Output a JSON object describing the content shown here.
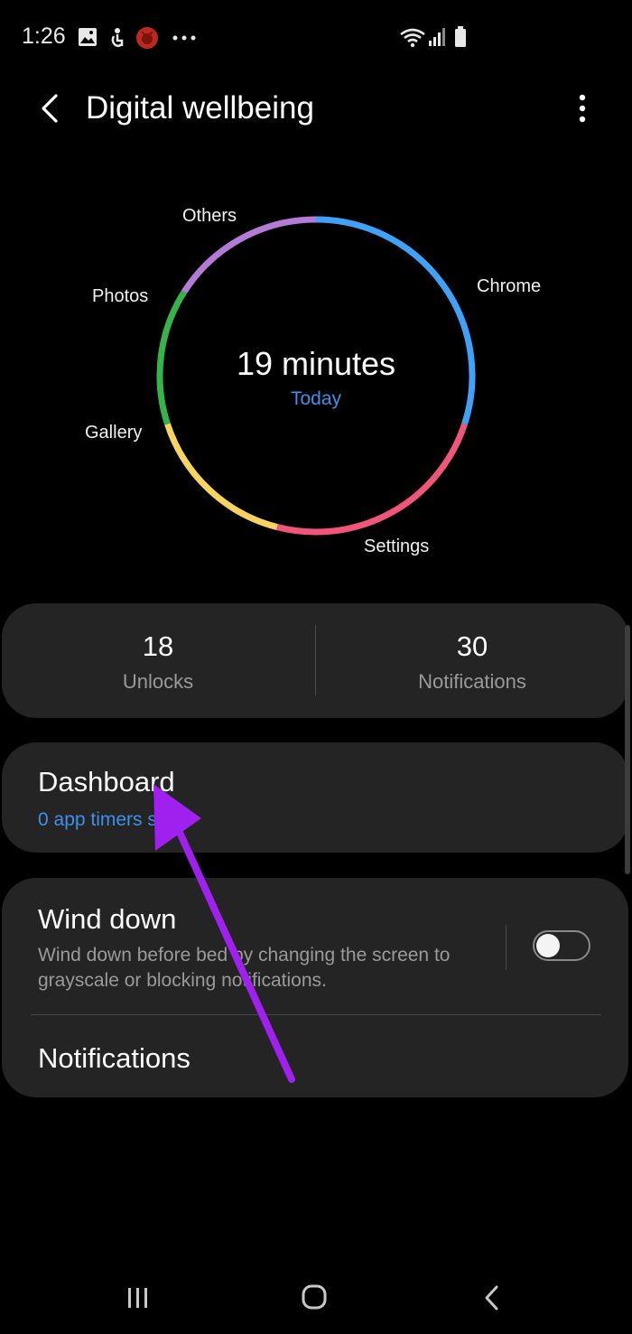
{
  "status_bar": {
    "time": "1:26",
    "left_icons": [
      "image-icon",
      "accessibility-icon",
      "app-notification-icon",
      "more-dots-icon"
    ],
    "right_icons": [
      "wifi-icon",
      "signal-icon",
      "battery-icon"
    ]
  },
  "header": {
    "title": "Digital wellbeing",
    "back_icon": "chevron-left-icon",
    "menu_icon": "more-vertical-icon"
  },
  "usage_chart": {
    "total": "19 minutes",
    "period": "Today",
    "chart_data": {
      "type": "pie",
      "segments": [
        {
          "name": "Chrome",
          "fraction": 0.3,
          "color": "#3fa2f7"
        },
        {
          "name": "Settings",
          "fraction": 0.24,
          "color": "#f2557a"
        },
        {
          "name": "Gallery",
          "fraction": 0.16,
          "color": "#f7d361"
        },
        {
          "name": "Photos",
          "fraction": 0.14,
          "color": "#34b44a"
        },
        {
          "name": "Others",
          "fraction": 0.16,
          "color": "#b47bd6"
        }
      ]
    }
  },
  "stats": {
    "unlocks_value": "18",
    "unlocks_label": "Unlocks",
    "notifications_value": "30",
    "notifications_label": "Notifications"
  },
  "dashboard": {
    "title": "Dashboard",
    "subtitle": "0 app timers set"
  },
  "wind_down": {
    "title": "Wind down",
    "description": "Wind down before bed by changing the screen to grayscale or blocking notifications.",
    "enabled": false
  },
  "notifications_item": {
    "title": "Notifications"
  },
  "colors": {
    "accent": "#3e91ea",
    "card": "#242424",
    "annotation_arrow": "#a020f0"
  },
  "nav_bar": {
    "icons": [
      "recent-apps-icon",
      "home-icon",
      "back-icon"
    ]
  }
}
